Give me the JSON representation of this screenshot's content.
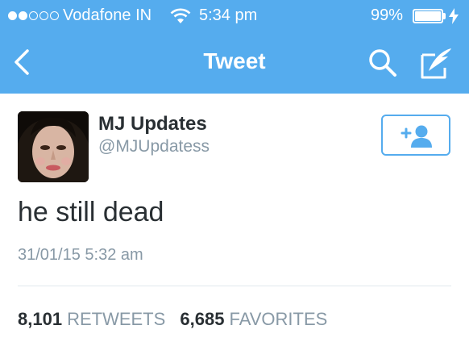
{
  "status_bar": {
    "signal_strength": "2 of 5",
    "carrier": "Vodafone IN",
    "time": "5:34 pm",
    "battery_percent": "99%",
    "battery_level": 0.99,
    "icons": [
      "signal-dots-icon",
      "wifi-icon",
      "battery-icon",
      "charging-bolt-icon"
    ]
  },
  "nav": {
    "title": "Tweet",
    "icons": [
      "back-chevron-icon",
      "search-icon",
      "compose-icon"
    ]
  },
  "tweet": {
    "display_name": "MJ Updates",
    "handle": "@MJUpdatess",
    "text": "he still dead",
    "timestamp": "31/01/15 5:32 am",
    "follow_icon": "follow-user-icon"
  },
  "stats": {
    "retweets_count": "8,101",
    "retweets_label": "RETWEETS",
    "favorites_count": "6,685",
    "favorites_label": "FAVORITES"
  },
  "colors": {
    "brand_blue": "#55acee",
    "text_dark": "#292f33",
    "text_gray": "#8899a6",
    "divider": "#e1e8ed"
  }
}
